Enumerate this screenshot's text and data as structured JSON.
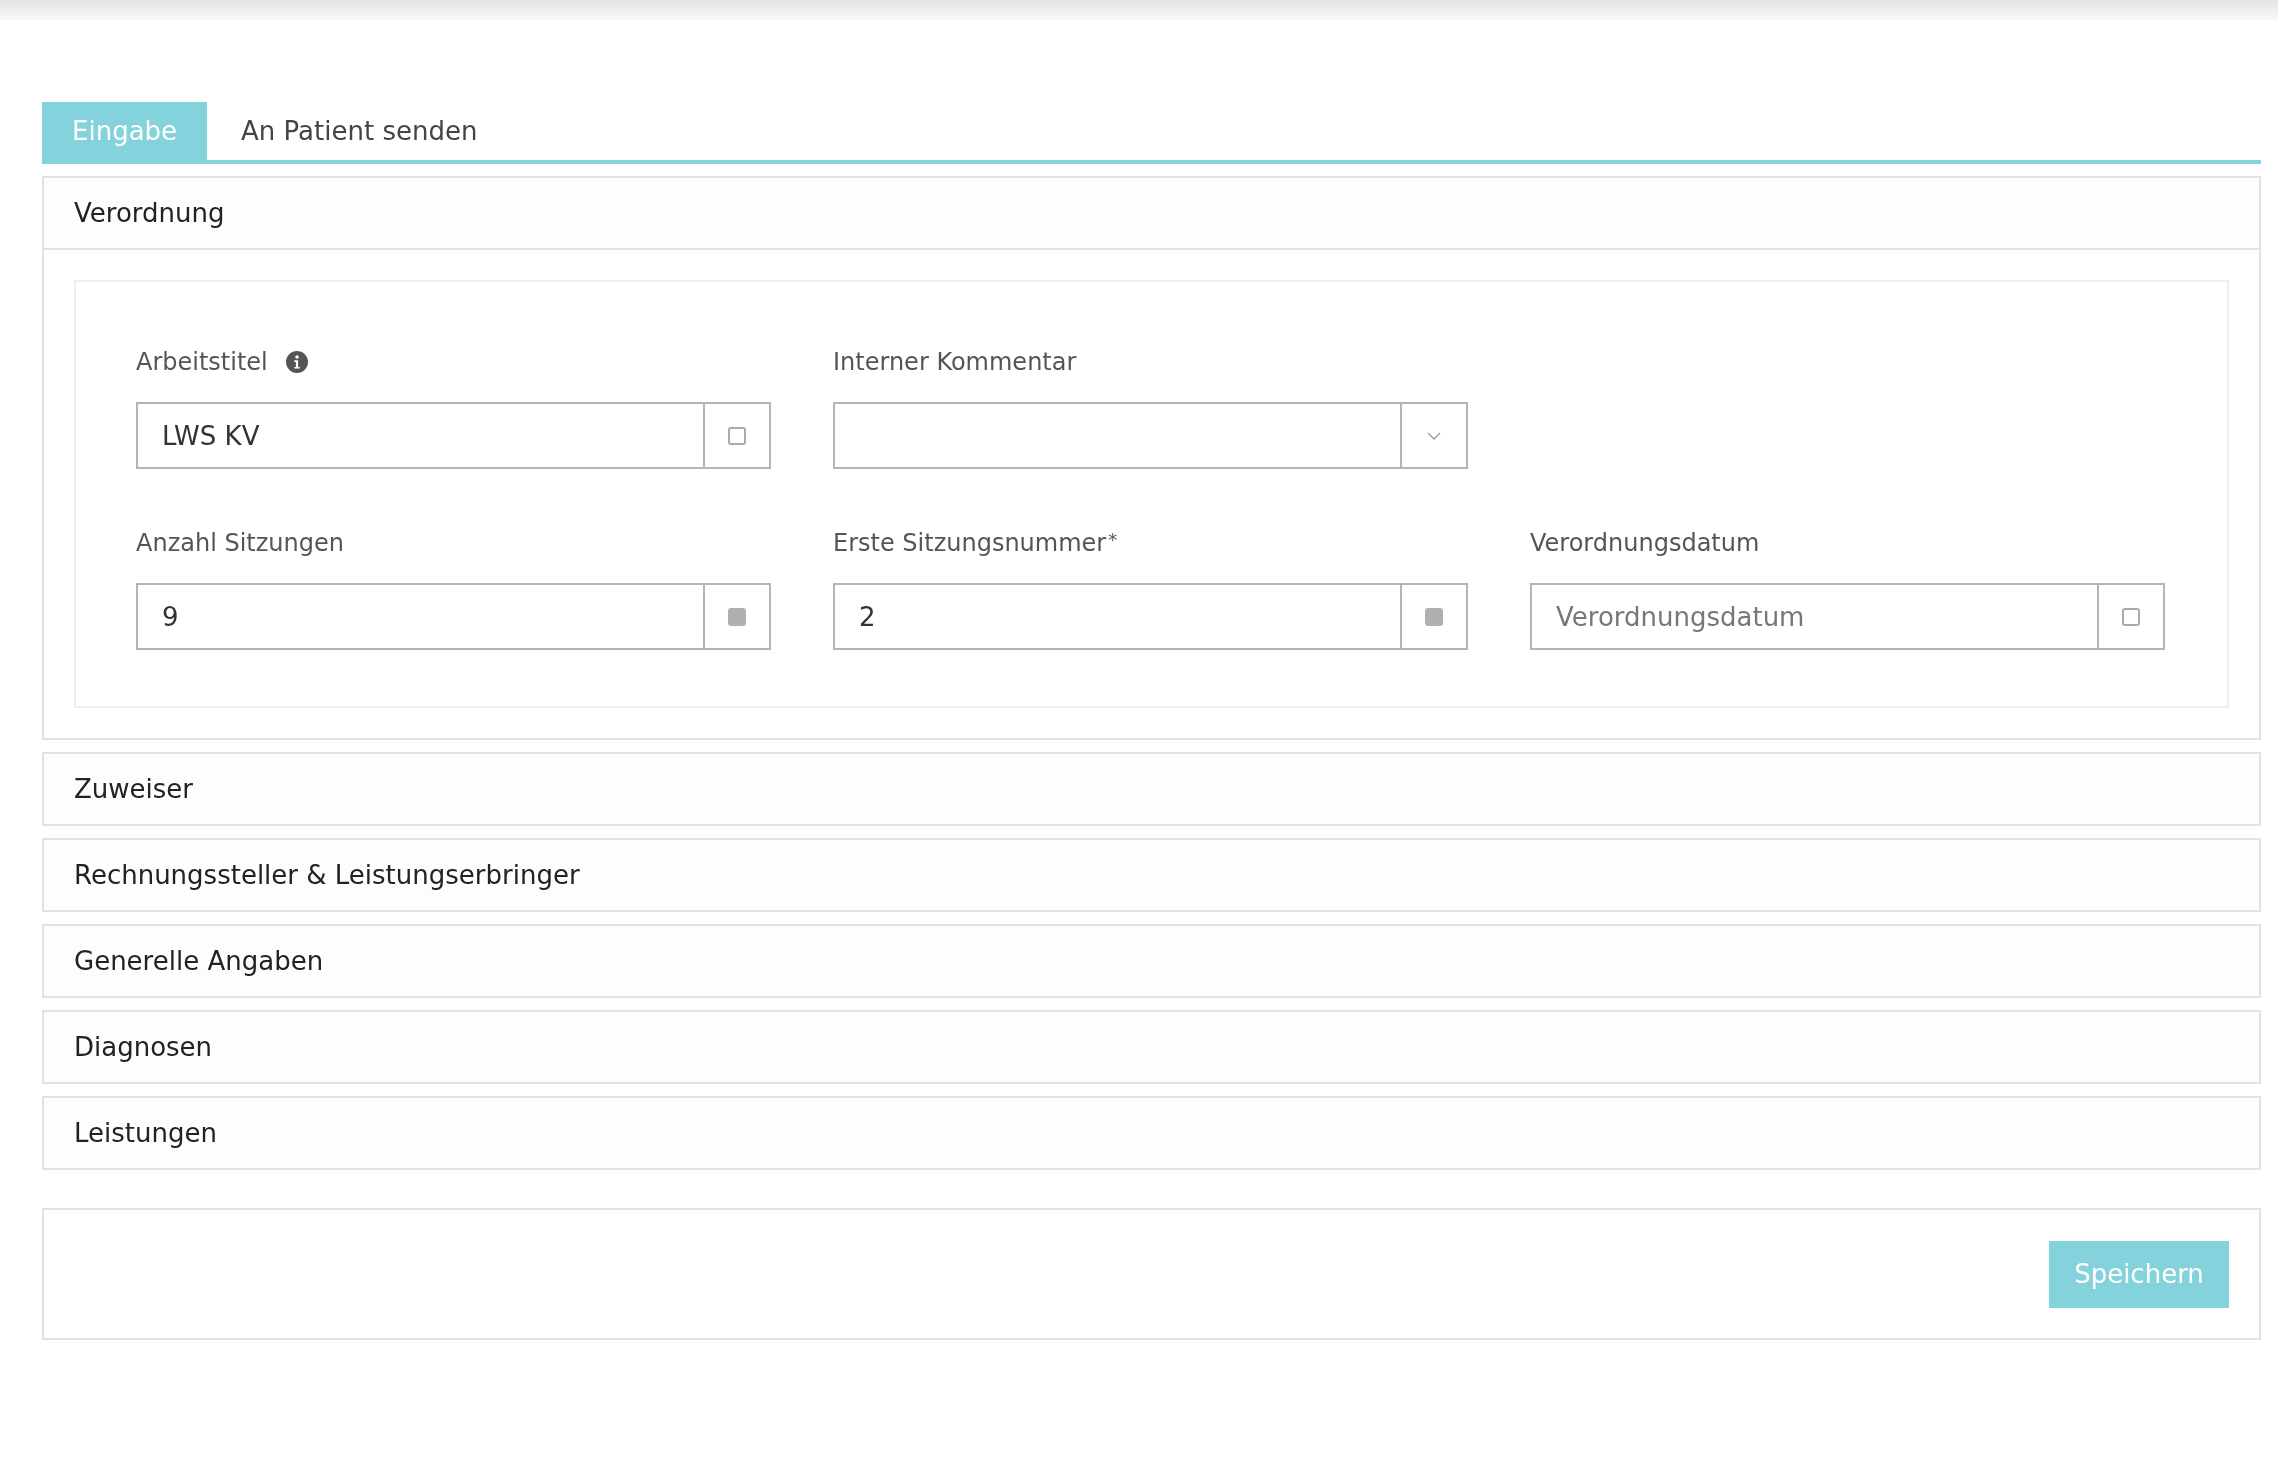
{
  "tabs": [
    {
      "label": "Eingabe",
      "selected": true
    },
    {
      "label": "An Patient senden",
      "selected": false
    }
  ],
  "sections": [
    {
      "title": "Verordnung",
      "expanded": true,
      "rows": [
        [
          {
            "label": "Arbeitstitel",
            "info": true,
            "value": "LWS KV",
            "addon": {
              "kind": "checkbox",
              "checked": false
            }
          },
          {
            "label": "Interner Kommentar",
            "addon": {
              "kind": "dropdown"
            }
          }
        ],
        [
          {
            "label": "Anzahl Sitzungen",
            "value": "9",
            "addon": {
              "kind": "checkbox",
              "checked": true
            }
          },
          {
            "label": "Erste Sitzungsnummer",
            "required_mark": "*",
            "value": "2",
            "addon": {
              "kind": "checkbox",
              "checked": true
            }
          },
          {
            "label": "Verordnungsdatum",
            "placeholder": "Verordnungsdatum",
            "addon": {
              "kind": "checkbox",
              "checked": false
            }
          }
        ]
      ]
    },
    {
      "title": "Zuweiser",
      "expanded": false
    },
    {
      "title": "Rechnungssteller & Leistungserbringer",
      "expanded": false
    },
    {
      "title": "Generelle Angaben",
      "expanded": false
    },
    {
      "title": "Diagnosen",
      "expanded": false
    },
    {
      "title": "Leistungen",
      "expanded": false
    }
  ],
  "save_button": "Speichern"
}
